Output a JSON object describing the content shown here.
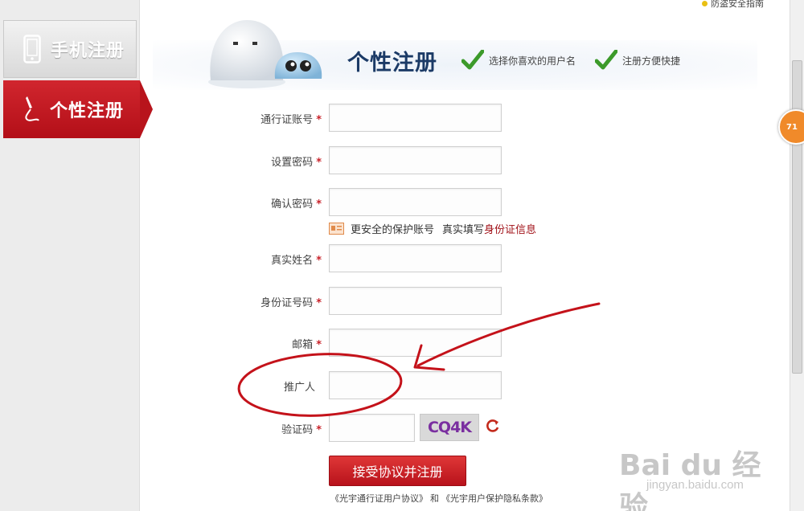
{
  "sidebar": {
    "tabs": [
      {
        "label": "手机注册",
        "icon": "mobile-phone-icon",
        "active": false
      },
      {
        "label": "个性注册",
        "icon": "pen-icon",
        "active": true
      }
    ]
  },
  "top_link": "防盗安全指南",
  "header": {
    "title": "个性注册",
    "features": [
      "选择你喜欢的用户名",
      "注册方便快捷"
    ]
  },
  "form": {
    "fields": [
      {
        "label": "通行证账号",
        "required": true,
        "value": ""
      },
      {
        "label": "设置密码",
        "required": true,
        "value": ""
      },
      {
        "label": "确认密码",
        "required": true,
        "value": ""
      },
      {
        "label": "真实姓名",
        "required": true,
        "value": ""
      },
      {
        "label": "身份证号码",
        "required": true,
        "value": ""
      },
      {
        "label": "邮箱",
        "required": true,
        "value": ""
      },
      {
        "label": "推广人",
        "required": false,
        "value": ""
      },
      {
        "label": "验证码",
        "required": true,
        "value": ""
      }
    ],
    "required_mark": "*",
    "id_tip": {
      "text": "更安全的保护账号",
      "prefix": "真实填写",
      "link": "身份证信息"
    },
    "captcha_text": "CQ4K",
    "submit_label": "接受协议并注册",
    "agreements": {
      "first": "《光宇通行证用户协议》",
      "conj": "和",
      "second": "《光宇用户保护隐私条款》"
    }
  },
  "float_badge": "71",
  "watermark": {
    "logo": "Bai du 经验",
    "sub": "jingyan.baidu.com"
  },
  "colors": {
    "brand_red": "#c9232b",
    "title_blue": "#1b3a66",
    "annotation_red": "#c4121a"
  }
}
